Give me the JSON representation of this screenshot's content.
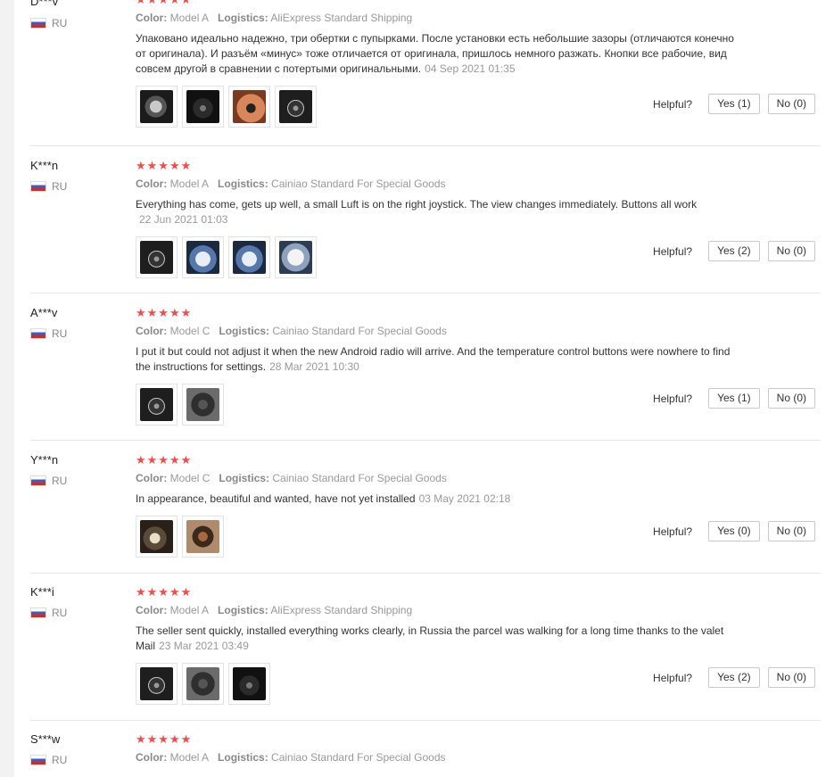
{
  "labels": {
    "color": "Color:",
    "logistics": "Logistics:",
    "helpful": "Helpful?",
    "stars": "★★★★★"
  },
  "reviews": [
    {
      "user": "D***v",
      "country": "RU",
      "color": "Model A",
      "logistics": "AliExpress Standard Shipping",
      "text": "Упаковано идеально надежно, три обертки с пупырками. После установки есть небольшие зазоры (отличаются конечно от оригинала). И разъём «минус» тоже отличается от оригинала, пришлось немного разжать. Кнопки все рабочие, вид совсем другой в сравнении с потертыми оригинальными.",
      "date": "04 Sep 2021 01:35",
      "yes": "Yes (1)",
      "no": "No (0)",
      "photos": [
        "steering-wheel-photo",
        "steering-wheel-photo",
        "steering-wheel-photo",
        "steering-wheel-photo"
      ]
    },
    {
      "user": "K***n",
      "country": "RU",
      "color": "Model A",
      "logistics": "Cainiao Standard For Special Goods",
      "text": "Everything has come, gets up well, a small Luft is on the right joystick. The view changes immediately. Buttons all work",
      "date": "22 Jun 2021 01:03",
      "yes": "Yes (2)",
      "no": "No (0)",
      "photos": [
        "steering-wheel-photo",
        "package-photo",
        "package-photo",
        "package-photo"
      ]
    },
    {
      "user": "A***v",
      "country": "RU",
      "color": "Model C",
      "logistics": "Cainiao Standard For Special Goods",
      "text": "I put it but could not adjust it when the new Android radio will arrive. And the temperature control buttons were nowhere to find the instructions for settings.",
      "date": "28 Mar 2021 10:30",
      "yes": "Yes (1)",
      "no": "No (0)",
      "photos": [
        "steering-wheel-photo",
        "steering-wheel-photo"
      ]
    },
    {
      "user": "Y***n",
      "country": "RU",
      "color": "Model C",
      "logistics": "Cainiao Standard For Special Goods",
      "text": "In appearance, beautiful and wanted, have not yet installed",
      "date": "03 May 2021 02:18",
      "yes": "Yes (0)",
      "no": "No (0)",
      "photos": [
        "steering-wheel-photo",
        "steering-wheel-photo"
      ]
    },
    {
      "user": "K***i",
      "country": "RU",
      "color": "Model A",
      "logistics": "AliExpress Standard Shipping",
      "text": "The seller sent quickly, installed everything works clearly, in Russia the parcel was walking for a long time thanks to the valet Mail",
      "date": "23 Mar 2021 03:49",
      "yes": "Yes (2)",
      "no": "No (0)",
      "photos": [
        "steering-wheel-photo",
        "steering-wheel-photo",
        "steering-wheel-photo"
      ]
    },
    {
      "user": "S***w",
      "country": "RU",
      "color": "Model A",
      "logistics": "Cainiao Standard For Special Goods"
    }
  ]
}
